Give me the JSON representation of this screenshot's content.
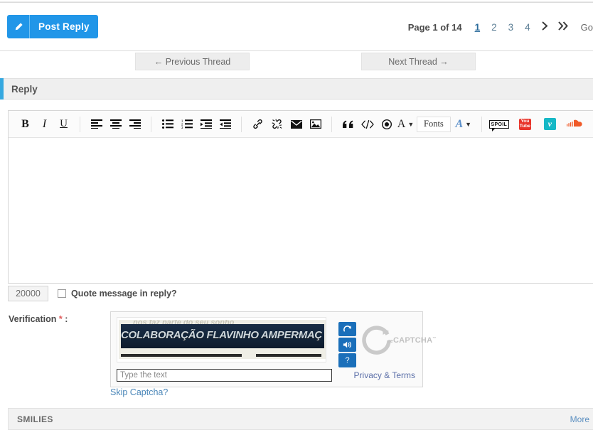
{
  "toolbar_top": {
    "post_reply_label": "Post Reply",
    "post_reply_icon": "pencil-icon"
  },
  "pagination": {
    "page_text": "Page 1 of 14",
    "pages": [
      "1",
      "2",
      "3",
      "4"
    ],
    "current_page": "1",
    "next_icon": "❯",
    "last_icon": "➤➤",
    "goto_label": "Go"
  },
  "thread_nav": {
    "previous_label": "← Previous Thread",
    "next_label": "Next Thread →"
  },
  "reply_panel": {
    "title": "Reply",
    "accent_color": "#35a8e0"
  },
  "editor": {
    "groups": [
      {
        "name": "text-format",
        "buttons": [
          {
            "name": "bold-icon",
            "glyph": "B",
            "style": "b-bold"
          },
          {
            "name": "italic-icon",
            "glyph": "I",
            "style": "b-ital"
          },
          {
            "name": "underline-icon",
            "glyph": "U",
            "style": "b-under"
          }
        ]
      },
      {
        "name": "alignment",
        "buttons": [
          {
            "name": "align-left-icon",
            "glyph": "",
            "style": "svg-align-left"
          },
          {
            "name": "align-center-icon",
            "glyph": "",
            "style": "svg-align-center"
          },
          {
            "name": "align-right-icon",
            "glyph": "",
            "style": "svg-align-right"
          }
        ]
      },
      {
        "name": "lists",
        "buttons": [
          {
            "name": "bullet-list-icon",
            "glyph": "",
            "style": "svg-ul"
          },
          {
            "name": "numbered-list-icon",
            "glyph": "",
            "style": "svg-ol"
          },
          {
            "name": "indent-icon",
            "glyph": "",
            "style": "svg-indent"
          },
          {
            "name": "outdent-icon",
            "glyph": "",
            "style": "svg-outdent"
          }
        ]
      },
      {
        "name": "insert",
        "buttons": [
          {
            "name": "link-icon",
            "glyph": "",
            "style": "svg-link"
          },
          {
            "name": "unlink-icon",
            "glyph": "",
            "style": "svg-unlink"
          },
          {
            "name": "email-icon",
            "glyph": "✉",
            "style": "svg-mail"
          },
          {
            "name": "image-icon",
            "glyph": "",
            "style": "svg-image"
          }
        ]
      },
      {
        "name": "blocks",
        "buttons": [
          {
            "name": "quote-icon",
            "glyph": "“",
            "style": "b-serif"
          },
          {
            "name": "code-icon",
            "glyph": "</>",
            "style": "code"
          },
          {
            "name": "media-icon",
            "glyph": "⊙",
            "style": "target"
          },
          {
            "name": "font-color-icon",
            "glyph": "A",
            "style": "b-serif"
          }
        ]
      }
    ],
    "fonts_label": "Fonts",
    "font-size_icon": "font-size-icon",
    "embeds": [
      {
        "name": "spoiler-icon",
        "label": "SPOIL",
        "color": "#111111"
      },
      {
        "name": "youtube-icon",
        "label": "You Tube",
        "color": "#e8342a"
      },
      {
        "name": "vimeo-icon",
        "label": "v",
        "color": "#16b8c6"
      },
      {
        "name": "soundcloud-icon",
        "label": "",
        "color": "#f05a28"
      }
    ],
    "content": ""
  },
  "counter": {
    "chars_remaining": "20000",
    "quote_label": "Quote message in reply?",
    "quote_checked": false
  },
  "verification": {
    "label": "Verification",
    "required_marker": "*",
    "colon": ":",
    "captcha_text": "COLABORAÇÃO FLAVINHO AMPERMAÇ",
    "captcha_ghost": "nos faz parte do seu sonho",
    "input_placeholder": "Type the text",
    "input_value": "",
    "buttons": [
      {
        "name": "captcha-refresh-button",
        "glyph": "⟳"
      },
      {
        "name": "captcha-audio-button",
        "glyph": "◀❙"
      },
      {
        "name": "captcha-help-button",
        "glyph": "?"
      }
    ],
    "logo_word": "CAPTCHA",
    "logo_prefix": "re",
    "logo_tm": "™",
    "privacy_label": "Privacy & Terms",
    "skip_label": "Skip Captcha?"
  },
  "smilies": {
    "title": "SMILIES",
    "more_label": "More"
  }
}
